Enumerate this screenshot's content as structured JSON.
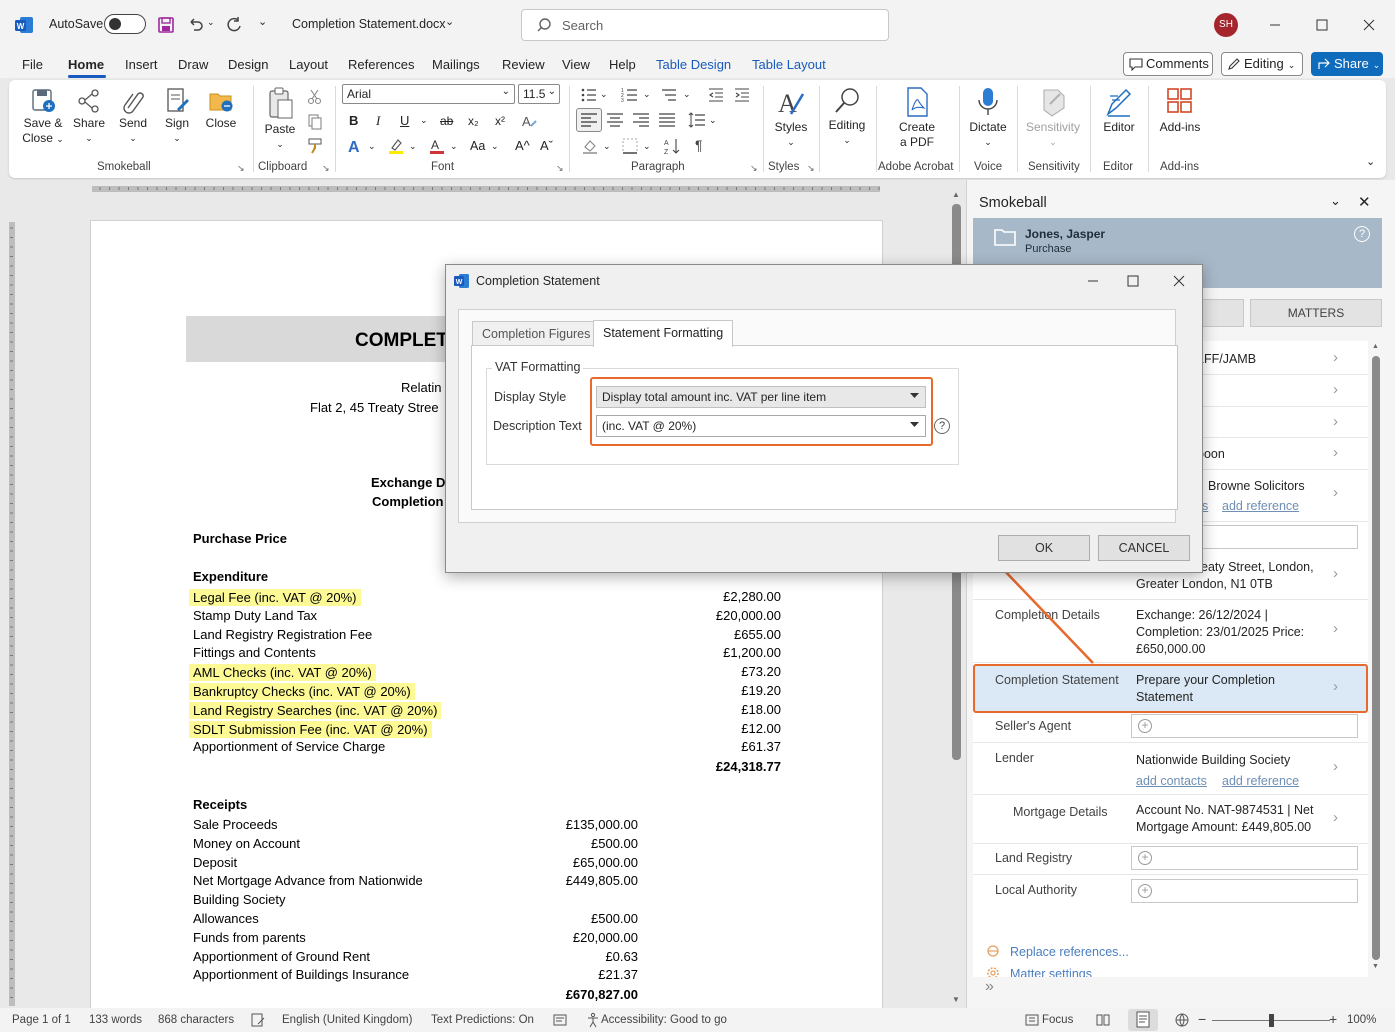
{
  "titlebar": {
    "autosave_label": "AutoSave",
    "doc_title": "Completion Statement.docx",
    "search_placeholder": "Search",
    "avatar_initials": "SH"
  },
  "menu": {
    "items": [
      "File",
      "Home",
      "Insert",
      "Draw",
      "Design",
      "Layout",
      "References",
      "Mailings",
      "Review",
      "View",
      "Help"
    ],
    "context_tabs": [
      "Table Design",
      "Table Layout"
    ],
    "comments": "Comments",
    "editing": "Editing",
    "share": "Share"
  },
  "ribbon": {
    "smokeball": {
      "save_close": "Save &",
      "save_close2": "Close",
      "share": "Share",
      "send": "Send",
      "sign": "Sign",
      "close": "Close",
      "group": "Smokeball"
    },
    "clipboard": {
      "paste": "Paste",
      "group": "Clipboard"
    },
    "font": {
      "name": "Arial",
      "size": "11.5",
      "group": "Font",
      "bold": "B",
      "italic": "I",
      "underline": "U",
      "strike": "ab",
      "sub": "x₂",
      "sup": "x²",
      "case": "Aa",
      "grow": "A^",
      "shrink": "Aˇ"
    },
    "paragraph": {
      "group": "Paragraph"
    },
    "styles": {
      "label": "Styles",
      "group": "Styles"
    },
    "editing": {
      "label": "Editing"
    },
    "pdf": {
      "label": "Create",
      "label2": "a PDF",
      "group": "Adobe Acrobat"
    },
    "voice": {
      "label": "Dictate",
      "group": "Voice"
    },
    "sensitivity": {
      "label": "Sensitivity",
      "group": "Sensitivity"
    },
    "editor": {
      "label": "Editor",
      "group": "Editor"
    },
    "addins": {
      "label": "Add-ins",
      "group": "Add-ins"
    }
  },
  "document": {
    "title": "COMPLET",
    "relating": "Relatin",
    "address": "Flat 2, 45 Treaty Stree",
    "exchange": "Exchange D",
    "completion": "Completion",
    "purchase_price": "Purchase Price",
    "expenditure_heading": "Expenditure",
    "expenditure": [
      {
        "label": "Legal Fee (inc. VAT @ 20%)",
        "amount": "£2,280.00",
        "highlight": true
      },
      {
        "label": "Stamp Duty Land Tax",
        "amount": "£20,000.00",
        "highlight": false
      },
      {
        "label": "Land Registry Registration Fee",
        "amount": "£655.00",
        "highlight": false
      },
      {
        "label": "Fittings and Contents",
        "amount": "£1,200.00",
        "highlight": false
      },
      {
        "label": "AML Checks (inc. VAT @ 20%)",
        "amount": "£73.20",
        "highlight": true
      },
      {
        "label": "Bankruptcy Checks (inc. VAT @ 20%)",
        "amount": "£19.20",
        "highlight": true
      },
      {
        "label": "Land Registry Searches (inc. VAT @ 20%)",
        "amount": "£18.00",
        "highlight": true
      },
      {
        "label": "SDLT Submission Fee (inc. VAT @ 20%)",
        "amount": "£12.00",
        "highlight": true
      },
      {
        "label": "Apportionment of Service Charge",
        "amount": "£61.37",
        "highlight": false
      }
    ],
    "expenditure_total": "£24,318.77",
    "receipts_heading": "Receipts",
    "receipts": [
      {
        "label": "Sale Proceeds",
        "amount": "£135,000.00"
      },
      {
        "label": "Money on Account",
        "amount": "£500.00"
      },
      {
        "label": "Deposit",
        "amount": "£65,000.00"
      },
      {
        "label": "Net Mortgage Advance from Nationwide",
        "amount": "£449,805.00"
      },
      {
        "label": "Building Society",
        "amount": ""
      },
      {
        "label": "Allowances",
        "amount": "£500.00"
      },
      {
        "label": "Funds from parents",
        "amount": "£20,000.00"
      },
      {
        "label": "Apportionment of Ground Rent",
        "amount": "£0.63"
      },
      {
        "label": "Apportionment of Buildings Insurance",
        "amount": "£21.37"
      }
    ],
    "receipts_total": "£670,827.00"
  },
  "dialog": {
    "title": "Completion Statement",
    "tabs": [
      "Completion Figures",
      "Statement Formatting"
    ],
    "group_title": "VAT Formatting",
    "display_style_label": "Display Style",
    "display_style_value": "Display total amount inc. VAT per line item",
    "description_label": "Description Text",
    "description_value": "(inc. VAT @ 20%)",
    "ok": "OK",
    "cancel": "CANCEL",
    "help": "?"
  },
  "pane": {
    "title": "Smokeball",
    "client_name": "Jones, Jasper",
    "matter_type": "Purchase",
    "help": "?",
    "tabs": [
      "MATTERS"
    ],
    "rows": [
      {
        "value": "LFF/JAMB"
      },
      {
        "value": "s"
      },
      {
        "value": ""
      },
      {
        "value": "poon"
      },
      {
        "value": "Browne Solicitors",
        "links": [
          "s",
          "add reference"
        ]
      },
      {
        "value": "eaty Street, London,",
        "value2": "Greater London, N1 0TB"
      }
    ],
    "completion_details": {
      "label": "Completion Details",
      "line1": "Exchange: 26/12/2024 |",
      "line2": "Completion: 23/01/2025   Price:",
      "line3": "£650,000.00"
    },
    "completion_statement": {
      "label": "Completion Statement",
      "line1": "Prepare your Completion",
      "line2": "Statement"
    },
    "sellers_agent": {
      "label": "Seller's Agent"
    },
    "lender": {
      "label": "Lender",
      "value": "Nationwide Building Society",
      "link1": "add contacts",
      "link2": "add reference"
    },
    "mortgage": {
      "label": "Mortgage Details",
      "line1": "Account No. NAT-9874531 | Net",
      "line2": "Mortgage Amount: £449,805.00"
    },
    "land_registry": {
      "label": "Land Registry"
    },
    "local_authority": {
      "label": "Local Authority"
    },
    "replace_refs": "Replace references...",
    "matter_settings": "Matter settings"
  },
  "status": {
    "page": "Page 1 of 1",
    "words": "133 words",
    "chars": "868 characters",
    "lang": "English (United Kingdom)",
    "predictions": "Text Predictions: On",
    "accessibility": "Accessibility: Good to go",
    "focus": "Focus",
    "zoom": "100%"
  },
  "colors": {
    "accent": "#185abd",
    "orange": "#e8692c",
    "highlight": "#fdfa96",
    "card": "#a7b8c8"
  }
}
